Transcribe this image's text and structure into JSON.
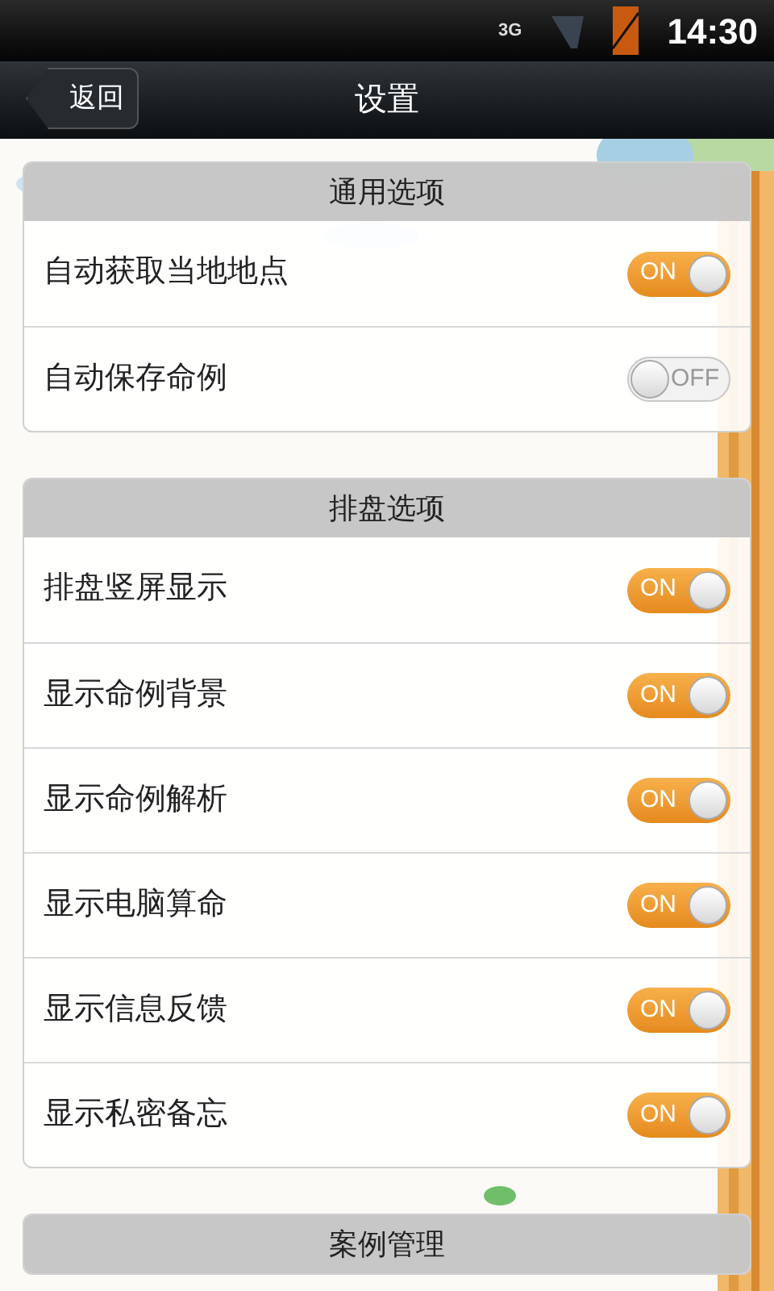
{
  "status_bar": {
    "network": "3G",
    "time": "14:30"
  },
  "nav_bar": {
    "back_button": "返回",
    "title": "设置"
  },
  "sections": [
    {
      "header": "通用选项",
      "rows": [
        {
          "label": "自动获取当地地点",
          "on": true,
          "toggle_text": "ON"
        },
        {
          "label": "自动保存命例",
          "on": false,
          "toggle_text": "OFF"
        }
      ]
    },
    {
      "header": "排盘选项",
      "rows": [
        {
          "label": "排盘竖屏显示",
          "on": true,
          "toggle_text": "ON"
        },
        {
          "label": "显示命例背景",
          "on": true,
          "toggle_text": "ON"
        },
        {
          "label": "显示命例解析",
          "on": true,
          "toggle_text": "ON"
        },
        {
          "label": "显示电脑算命",
          "on": true,
          "toggle_text": "ON"
        },
        {
          "label": "显示信息反馈",
          "on": true,
          "toggle_text": "ON"
        },
        {
          "label": "显示私密备忘",
          "on": true,
          "toggle_text": "ON"
        }
      ]
    },
    {
      "header": "案例管理"
    }
  ]
}
